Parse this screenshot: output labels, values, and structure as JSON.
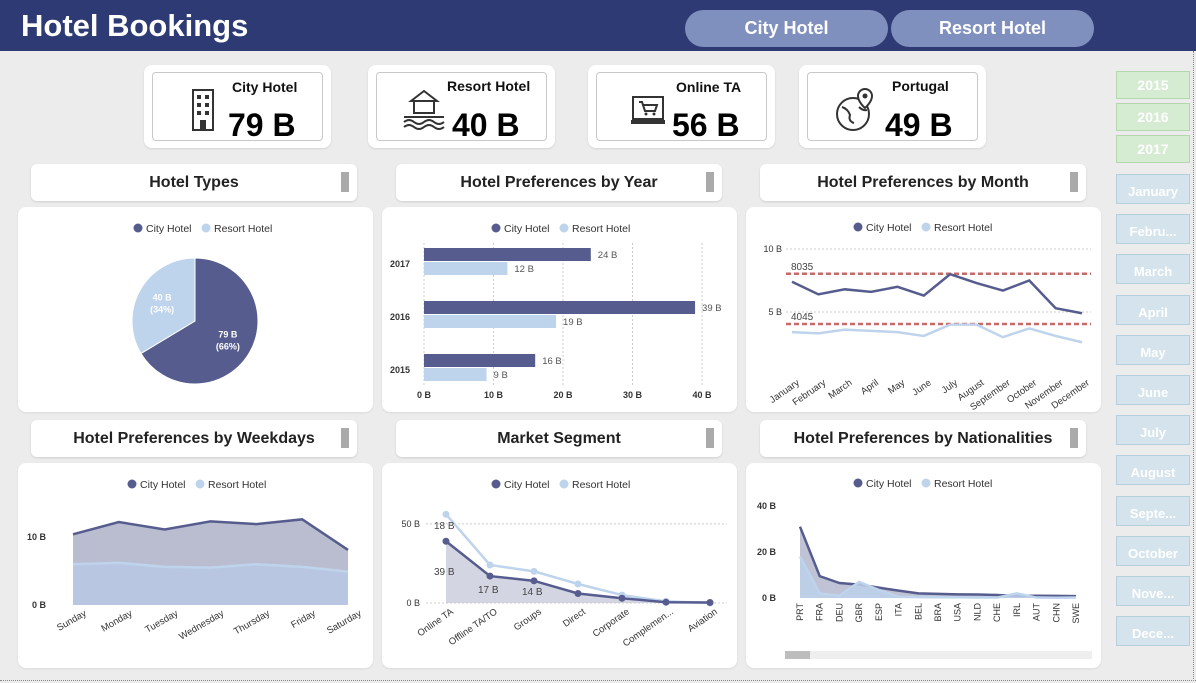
{
  "header": {
    "title": "Hotel Bookings",
    "buttons": [
      "City Hotel",
      "Resort Hotel"
    ]
  },
  "kpis": [
    {
      "label": "City Hotel",
      "value": "79 B",
      "icon": "building-icon"
    },
    {
      "label": "Resort Hotel",
      "value": "40 B",
      "icon": "resort-icon"
    },
    {
      "label": "Online TA",
      "value": "56 B",
      "icon": "online-cart-icon"
    },
    {
      "label": "Portugal",
      "value": "49 B",
      "icon": "globe-pin-icon"
    }
  ],
  "panels": {
    "types": "Hotel Types",
    "year": "Hotel Preferences by Year",
    "month": "Hotel Preferences by Month",
    "weekdays": "Hotel Preferences by Weekdays",
    "segment": "Market Segment",
    "nationalities": "Hotel Preferences by Nationalities"
  },
  "legend": {
    "city": "City Hotel",
    "resort": "Resort Hotel"
  },
  "colors": {
    "city": "#565d8e",
    "resort": "#bed3ec",
    "header": "#2e3a73",
    "ref_line": "#c0504d"
  },
  "slicers": {
    "years": [
      "2015",
      "2016",
      "2017"
    ],
    "months": [
      "January",
      "Febru...",
      "March",
      "April",
      "May",
      "June",
      "July",
      "August",
      "Septe...",
      "October",
      "Nove...",
      "Dece..."
    ]
  },
  "chart_data": [
    {
      "type": "pie",
      "categories": [
        "City Hotel",
        "Resort Hotel"
      ],
      "values": [
        79,
        40
      ],
      "labels": [
        "79 B\n(66%)",
        "40 B\n(34%)"
      ]
    },
    {
      "type": "bar",
      "orientation": "horizontal",
      "categories": [
        "2017",
        "2016",
        "2015"
      ],
      "series": [
        {
          "name": "City Hotel",
          "values": [
            24,
            39,
            16
          ],
          "labels": [
            "24 B",
            "39 B",
            "16 B"
          ]
        },
        {
          "name": "Resort Hotel",
          "values": [
            12,
            19,
            9
          ],
          "labels": [
            "12 B",
            "19 B",
            "9 B"
          ]
        }
      ],
      "xticks": [
        "0 B",
        "10 B",
        "20 B",
        "30 B",
        "40 B"
      ],
      "xlim": [
        0,
        40
      ]
    },
    {
      "type": "line",
      "categories": [
        "January",
        "February",
        "March",
        "April",
        "May",
        "June",
        "July",
        "August",
        "September",
        "October",
        "November",
        "December"
      ],
      "series": [
        {
          "name": "City Hotel",
          "values": [
            7.4,
            6.4,
            6.8,
            6.6,
            7.0,
            6.3,
            8.0,
            7.3,
            6.7,
            7.5,
            5.3,
            4.9
          ]
        },
        {
          "name": "Resort Hotel",
          "values": [
            3.4,
            3.3,
            3.6,
            3.5,
            3.4,
            3.1,
            4.0,
            4.0,
            3.0,
            3.7,
            3.1,
            2.6
          ]
        }
      ],
      "reference_lines": [
        {
          "value": 8.035,
          "label": "8035"
        },
        {
          "value": 4.045,
          "label": "4045"
        }
      ],
      "yticks": [
        "5 B",
        "10 B"
      ],
      "ylim": [
        0,
        10
      ]
    },
    {
      "type": "area",
      "categories": [
        "Sunday",
        "Monday",
        "Tuesday",
        "Wednesday",
        "Thursday",
        "Friday",
        "Saturday"
      ],
      "series": [
        {
          "name": "City Hotel",
          "values": [
            10.4,
            12.2,
            11.1,
            12.3,
            11.9,
            12.6,
            8.1
          ]
        },
        {
          "name": "Resort Hotel",
          "values": [
            6.0,
            6.2,
            5.6,
            5.5,
            6.0,
            5.6,
            4.9
          ]
        }
      ],
      "yticks": [
        "0 B",
        "10 B"
      ],
      "ylim": [
        0,
        15
      ]
    },
    {
      "type": "line",
      "categories": [
        "Online TA",
        "Offline TA/TO",
        "Groups",
        "Direct",
        "Corporate",
        "Complemen...",
        "Aviation"
      ],
      "series": [
        {
          "name": "City Hotel",
          "values": [
            39,
            17,
            14,
            6,
            3,
            0.5,
            0.3
          ],
          "labels": [
            "39 B",
            "17 B",
            "14 B"
          ]
        },
        {
          "name": "Resort Hotel",
          "values": [
            56,
            24,
            20,
            12,
            5,
            1,
            0
          ]
        }
      ],
      "annotations": [
        "18 B"
      ],
      "yticks": [
        "0 B",
        "50 B"
      ],
      "ylim": [
        0,
        60
      ]
    },
    {
      "type": "area",
      "categories": [
        "PRT",
        "FRA",
        "DEU",
        "GBR",
        "ESP",
        "ITA",
        "BEL",
        "BRA",
        "USA",
        "NLD",
        "CHE",
        "IRL",
        "AUT",
        "CHN",
        "SWE"
      ],
      "series": [
        {
          "name": "City Hotel",
          "values": [
            31,
            9.5,
            6.5,
            5.8,
            4.5,
            3.2,
            2.0,
            1.8,
            1.6,
            1.5,
            1.3,
            0.9,
            1.0,
            0.9,
            0.8
          ]
        },
        {
          "name": "Resort Hotel",
          "values": [
            18,
            2.0,
            1.0,
            7.0,
            3.5,
            0.5,
            0.4,
            0.3,
            0.3,
            0.2,
            0.2,
            2.0,
            0.2,
            0.1,
            0.2
          ]
        }
      ],
      "yticks": [
        "0 B",
        "20 B",
        "40 B"
      ],
      "ylim": [
        0,
        40
      ]
    }
  ]
}
